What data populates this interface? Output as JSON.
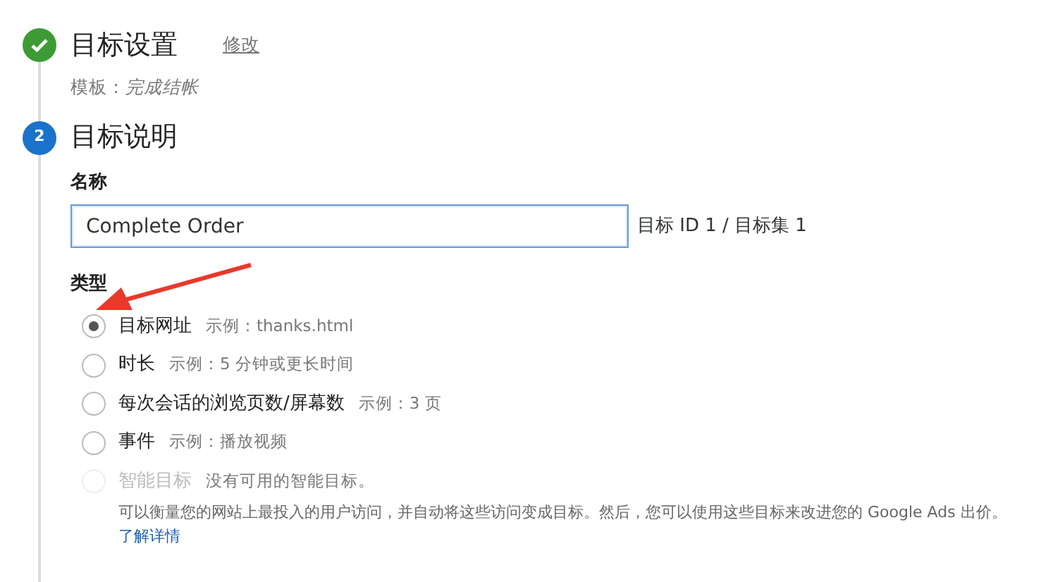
{
  "steps": [
    {
      "done": true,
      "title": "目标设置",
      "action": "修改",
      "summary": "模板：*完成结帐*"
    },
    {
      "done": false,
      "number": "2",
      "title": "目标说明"
    }
  ],
  "name_field": {
    "label": "名称",
    "value": "Complete Order",
    "note": "目标 ID 1 / 目标集 1"
  },
  "type_group": {
    "label": "类型",
    "options": [
      {
        "label": "目标网址",
        "example": "示例：thanks.html",
        "selected": true,
        "disabled": false
      },
      {
        "label": "时长",
        "example": "示例：5 分钟或更长时间",
        "selected": false,
        "disabled": false
      },
      {
        "label": "每次会话的浏览页数/屏幕数",
        "example": "示例：3 页",
        "selected": false,
        "disabled": false
      },
      {
        "label": "事件",
        "example": "示例：播放视频",
        "selected": false,
        "disabled": false
      },
      {
        "label": "智能目标",
        "example": "没有可用的智能目标。",
        "selected": false,
        "disabled": true
      }
    ],
    "description": "可以衡量您的网站上最投入的用户访问，并自动将这些访问变成目标。然后，您可以使用这些目标来改进您的 Google Ads 出价。",
    "link": "了解详情"
  }
}
